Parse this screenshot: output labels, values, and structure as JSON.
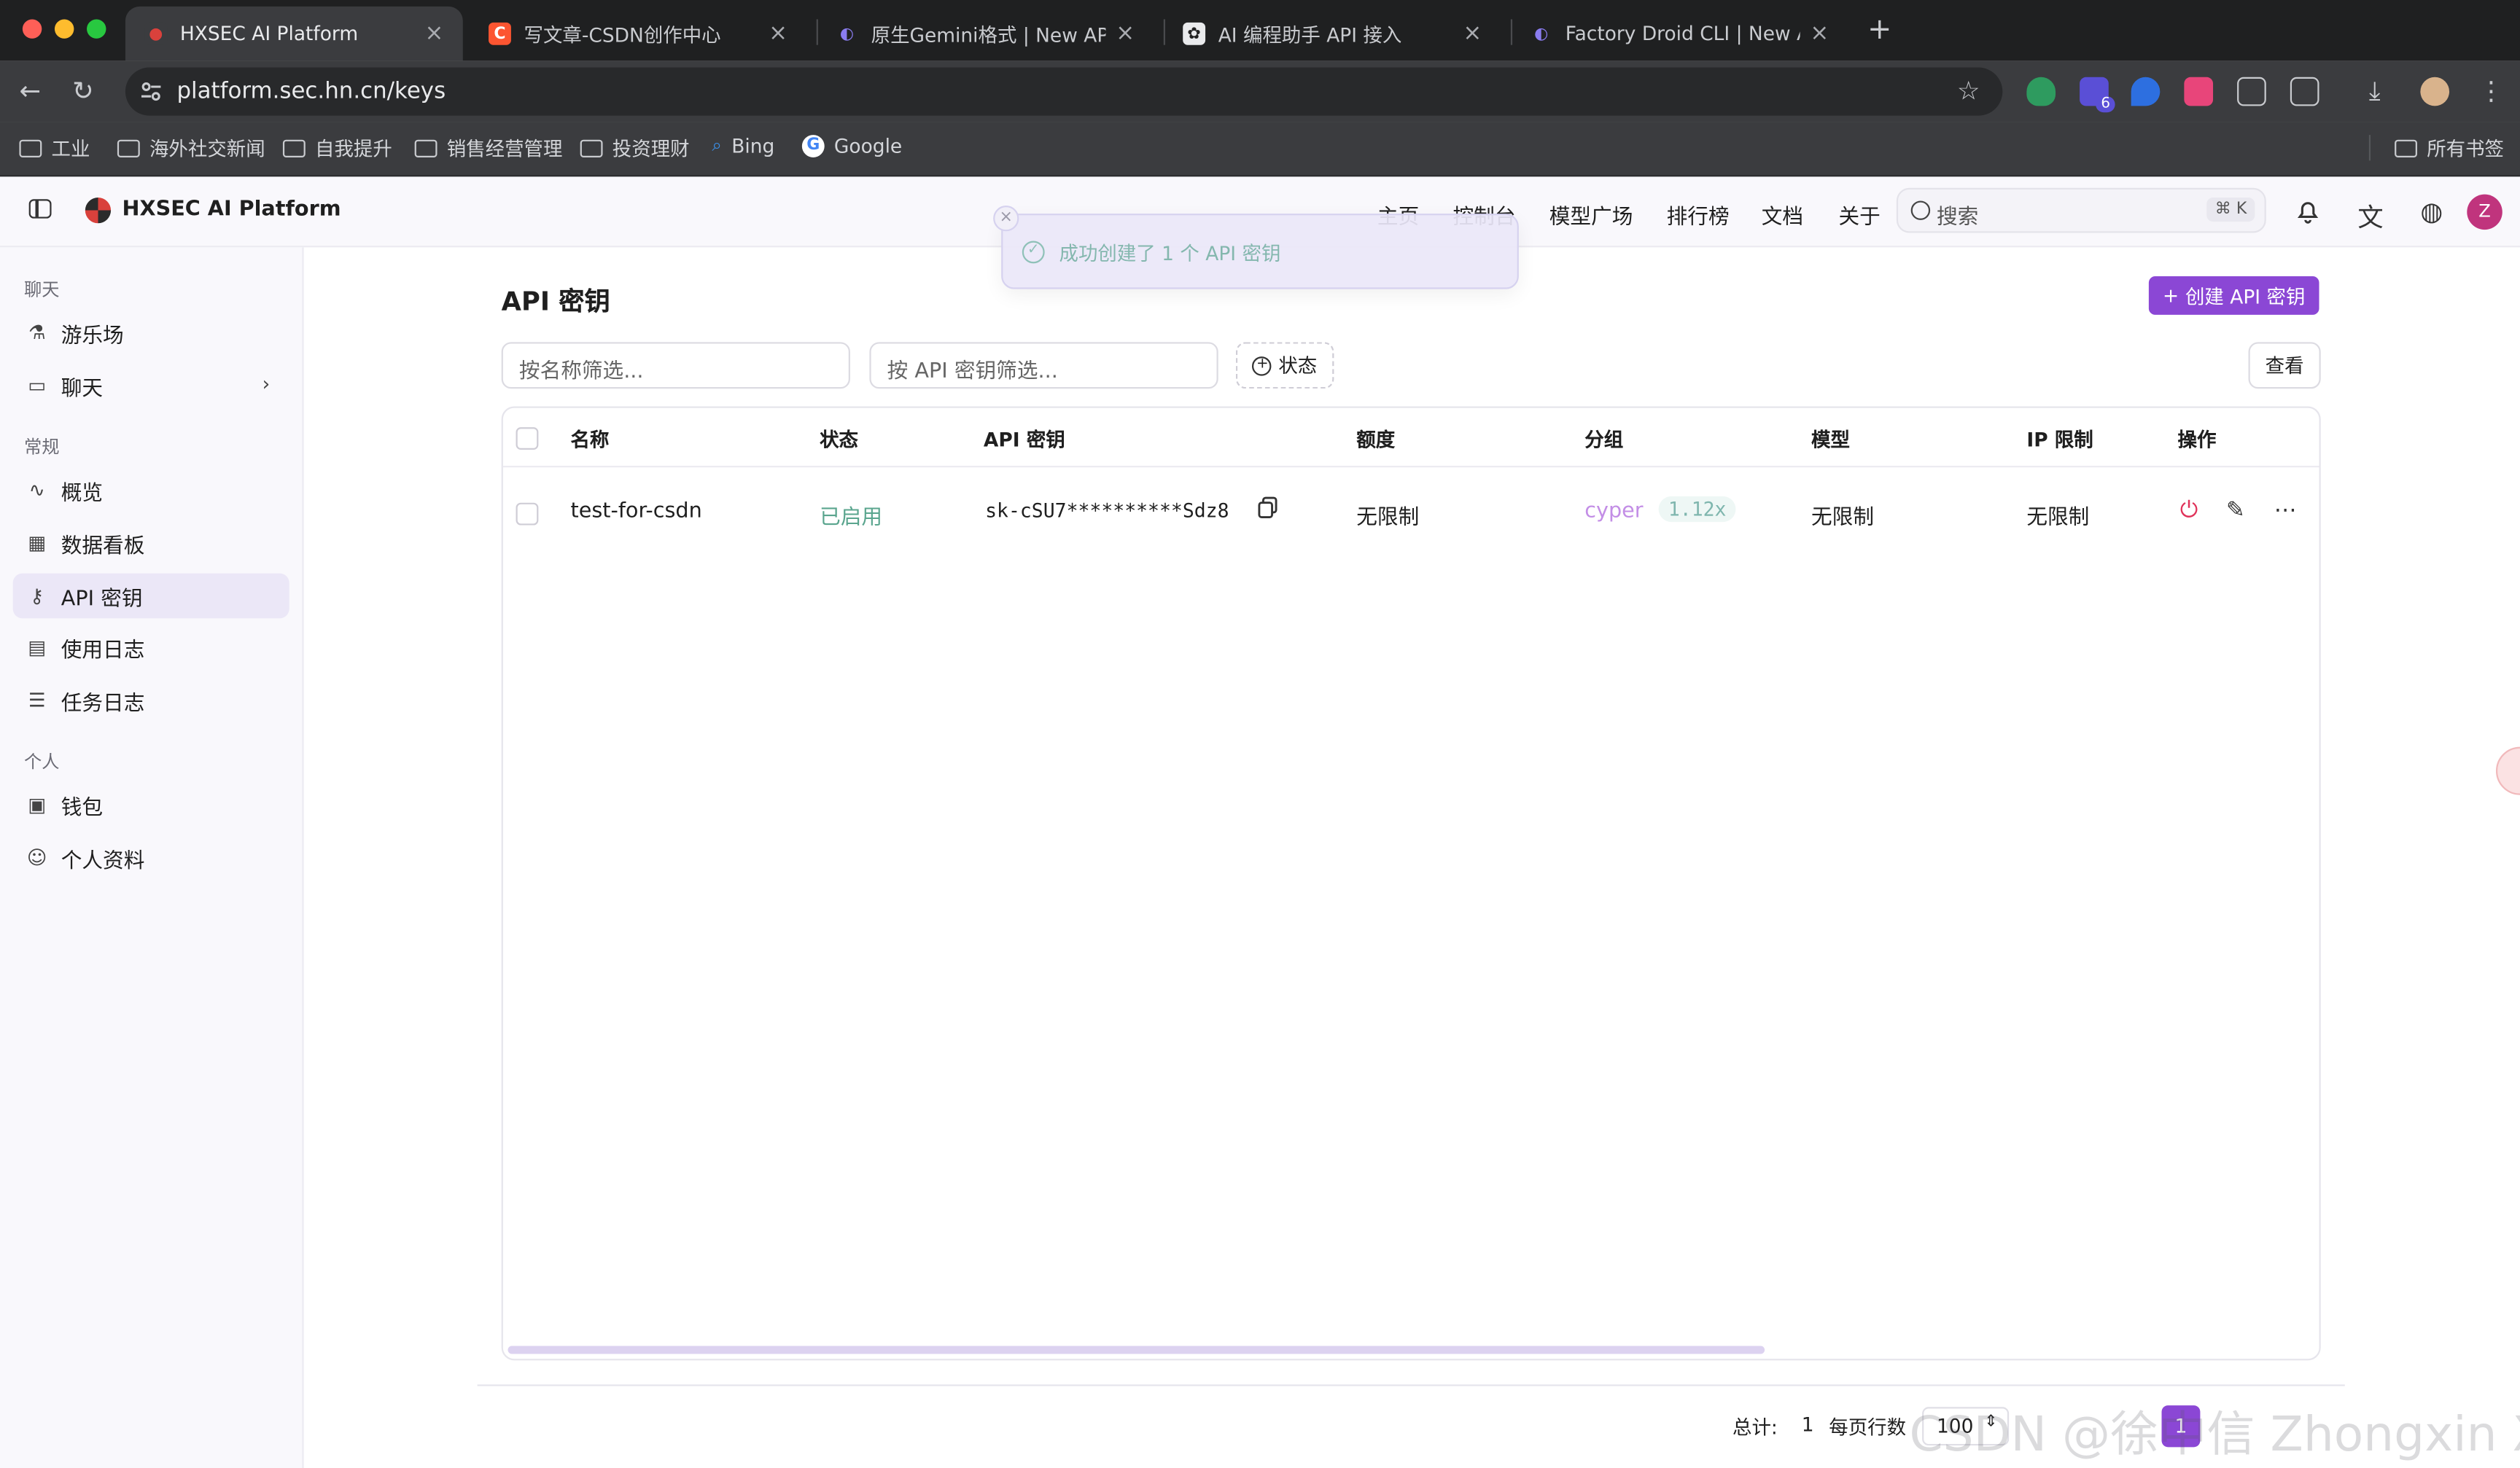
{
  "browser": {
    "tabs": [
      {
        "title": "HXSEC AI Platform",
        "active": true
      },
      {
        "title": "写文章-CSDN创作中心",
        "active": false
      },
      {
        "title": "原生Gemini格式 | New API",
        "active": false
      },
      {
        "title": "AI 编程助手 API 接入",
        "active": false
      },
      {
        "title": "Factory Droid CLI | New API",
        "active": false
      }
    ],
    "url": "platform.sec.hn.cn/keys",
    "bookmarks": [
      {
        "label": "工业",
        "icon": "folder-icon"
      },
      {
        "label": "海外社交新闻",
        "icon": "folder-icon"
      },
      {
        "label": "自我提升",
        "icon": "folder-icon"
      },
      {
        "label": "销售经营管理",
        "icon": "folder-icon"
      },
      {
        "label": "投资理财",
        "icon": "folder-icon"
      },
      {
        "label": "Bing",
        "icon": "bing-icon"
      },
      {
        "label": "Google",
        "icon": "google-icon"
      }
    ],
    "all_bookmarks": "所有书签",
    "extension_badge": "6"
  },
  "header": {
    "brand": "HXSEC AI Platform",
    "nav": [
      "主页",
      "控制台",
      "模型广场",
      "排行榜",
      "文档",
      "关于"
    ],
    "search_placeholder": "搜索",
    "search_shortcut": "⌘ K",
    "avatar_letter": "Z"
  },
  "toast": {
    "message": "成功创建了 1 个 API 密钥"
  },
  "sidebar": {
    "sections": [
      {
        "title": "聊天",
        "items": [
          {
            "label": "游乐场",
            "icon": "flask-icon"
          },
          {
            "label": "聊天",
            "icon": "chat-icon"
          }
        ]
      },
      {
        "title": "常规",
        "items": [
          {
            "label": "概览",
            "icon": "activity-icon"
          },
          {
            "label": "数据看板",
            "icon": "dashboard-icon"
          },
          {
            "label": "API 密钥",
            "icon": "key-icon"
          },
          {
            "label": "使用日志",
            "icon": "log-icon"
          },
          {
            "label": "任务日志",
            "icon": "task-list-icon"
          }
        ]
      },
      {
        "title": "个人",
        "items": [
          {
            "label": "钱包",
            "icon": "wallet-icon"
          },
          {
            "label": "个人资料",
            "icon": "user-icon"
          }
        ]
      }
    ]
  },
  "main": {
    "title": "API 密钥",
    "create_button": "创建 API 密钥",
    "filter_name_placeholder": "按名称筛选...",
    "filter_key_placeholder": "按 API 密钥筛选...",
    "status_filter": "状态",
    "view_button": "查看",
    "table": {
      "columns": [
        "名称",
        "状态",
        "API 密钥",
        "额度",
        "分组",
        "模型",
        "IP 限制",
        "操作"
      ],
      "rows": [
        {
          "name": "test-for-csdn",
          "status": "已启用",
          "key": "sk-cSU7**********Sdz8",
          "quota": "无限制",
          "group": "cyper",
          "ratio": "1.12x",
          "models": "无限制",
          "ip_limit": "无限制"
        }
      ]
    },
    "pagination": {
      "total_label": "总计:",
      "total": "1",
      "rows_per_page_label": "每页行数",
      "rows_per_page": "100",
      "current_page": "1"
    }
  },
  "watermark": "CSDN @徐中信 Zhongxin Xu",
  "colors": {
    "accent": "#8b47d5",
    "status_enabled": "#5aa58e",
    "group_tag": "#c38ee6"
  }
}
